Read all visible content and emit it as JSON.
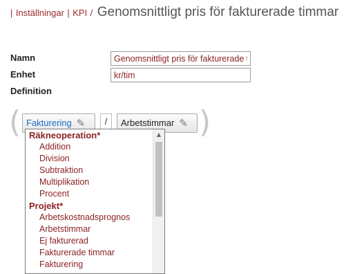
{
  "breadcrumb": {
    "separator": "|",
    "links": [
      "Inställningar",
      "KPI"
    ],
    "slash": "/",
    "page_title": "Genomsnittligt pris för fakturerade timmar"
  },
  "form": {
    "name_label": "Namn",
    "name_value": "Genomsnittligt pris för fakturerade timmar",
    "unit_label": "Enhet",
    "unit_value": "kr/tim",
    "definition_label": "Definition"
  },
  "formula": {
    "open_paren": "(",
    "close_paren": ")",
    "left_operand": "Fakturering",
    "operator": "/",
    "right_operand": "Arbetstimmar",
    "edit_icon": "pencil-icon"
  },
  "dropdown": {
    "groups": [
      {
        "label": "Räkneoperation*",
        "items": [
          "Addition",
          "Division",
          "Subtraktion",
          "Multiplikation",
          "Procent"
        ]
      },
      {
        "label": "Projekt*",
        "items": [
          "Arbetskostnadsprognos",
          "Arbetstimmar",
          "Ej fakturerad",
          "Fakturerade timmar",
          "Fakturering"
        ]
      }
    ],
    "scroll_up_icon": "▲"
  },
  "colors": {
    "accent": "#8b2323",
    "link_blue": "#1a6fc7"
  }
}
